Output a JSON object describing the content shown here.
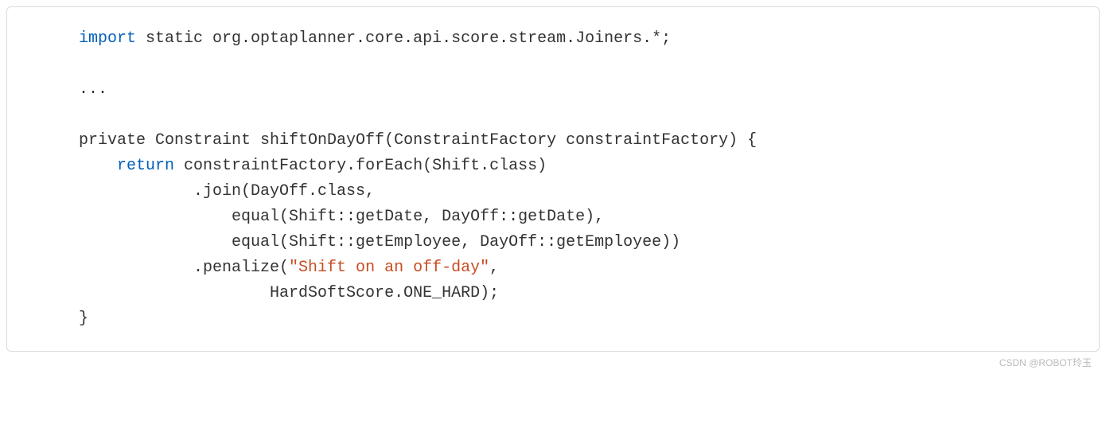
{
  "code": {
    "line1_kw": "import",
    "line1_rest": " static org.optaplanner.core.api.score.stream.Joiners.*;",
    "line2": "",
    "line3": "...",
    "line4": "",
    "line5": "private Constraint shiftOnDayOff(ConstraintFactory constraintFactory) {",
    "line6_indent": "    ",
    "line6_kw": "return",
    "line6_rest": " constraintFactory.forEach(Shift.class)",
    "line7": "            .join(DayOff.class,",
    "line8": "                equal(Shift::getDate, DayOff::getDate),",
    "line9": "                equal(Shift::getEmployee, DayOff::getEmployee))",
    "line10_a": "            .penalize(",
    "line10_str": "\"Shift on an off-day\"",
    "line10_b": ",",
    "line11": "                    HardSoftScore.ONE_HARD);",
    "line12": "}"
  },
  "watermark": "CSDN @ROBOT玲玉"
}
